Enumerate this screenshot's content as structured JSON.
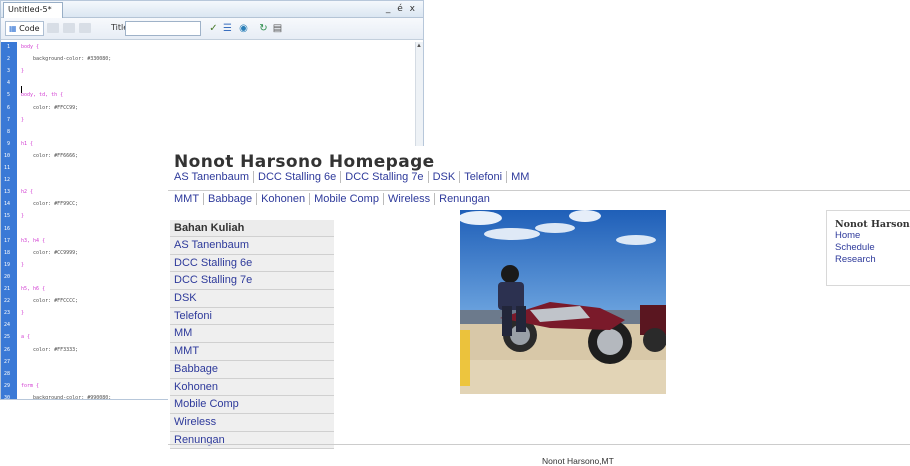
{
  "editor": {
    "tab_title": "Untitled-5*",
    "window_controls": "_ é x",
    "toolbar": {
      "code_label": "Code",
      "title_label": "Title:",
      "title_value": ""
    },
    "line_numbers": [
      "1",
      "2",
      "3",
      "4",
      "5",
      "6",
      "7",
      "8",
      "9",
      "10",
      "11",
      "12",
      "13",
      "14",
      "15",
      "16",
      "17",
      "18",
      "19",
      "20",
      "21",
      "22",
      "23",
      "24",
      "25",
      "26",
      "27",
      "28",
      "29",
      "30"
    ],
    "code_lines": [
      {
        "sel": "body {",
        "prop": ""
      },
      {
        "sel": "",
        "prop": "    background-color: #330080;"
      },
      {
        "sel": "}",
        "prop": ""
      },
      {
        "sel": "",
        "prop": ""
      },
      {
        "sel": "body, td, th {",
        "prop": ""
      },
      {
        "sel": "",
        "prop": "    color: #FFCC99;"
      },
      {
        "sel": "}",
        "prop": ""
      },
      {
        "sel": "",
        "prop": ""
      },
      {
        "sel": "h1 {",
        "prop": ""
      },
      {
        "sel": "",
        "prop": "    color: #FF6666;"
      },
      {
        "sel": "",
        "prop": ""
      },
      {
        "sel": "",
        "prop": ""
      },
      {
        "sel": "h2 {",
        "prop": ""
      },
      {
        "sel": "",
        "prop": "    color: #FF99CC;"
      },
      {
        "sel": "}",
        "prop": ""
      },
      {
        "sel": "",
        "prop": ""
      },
      {
        "sel": "h3, h4 {",
        "prop": ""
      },
      {
        "sel": "",
        "prop": "    color: #CC9999;"
      },
      {
        "sel": "}",
        "prop": ""
      },
      {
        "sel": "",
        "prop": ""
      },
      {
        "sel": "h5, h6 {",
        "prop": ""
      },
      {
        "sel": "",
        "prop": "    color: #FFCCCC;"
      },
      {
        "sel": "}",
        "prop": ""
      },
      {
        "sel": "",
        "prop": ""
      },
      {
        "sel": "a {",
        "prop": ""
      },
      {
        "sel": "",
        "prop": "    color: #FF3333;"
      },
      {
        "sel": "",
        "prop": ""
      },
      {
        "sel": "",
        "prop": ""
      },
      {
        "sel": "form {",
        "prop": ""
      },
      {
        "sel": "",
        "prop": "    background-color: #990080;"
      }
    ]
  },
  "site": {
    "title": "Nonot Harsono Homepage",
    "nav_row1": [
      "AS Tanenbaum",
      "DCC Stalling 6e",
      "DCC Stalling 7e",
      "DSK",
      "Telefoni",
      "MM"
    ],
    "nav_row2": [
      "MMT",
      "Babbage",
      "Kohonen",
      "Mobile Comp",
      "Wireless",
      "Renungan"
    ],
    "sidebar": {
      "heading": "Bahan Kuliah",
      "items": [
        "AS Tanenbaum",
        "DCC Stalling 6e",
        "DCC Stalling 7e",
        "DSK",
        "Telefoni",
        "MM",
        "MMT",
        "Babbage",
        "Kohonen",
        "Mobile Comp",
        "Wireless",
        "Renungan"
      ]
    },
    "right_box": {
      "name": "Nonot Harsono",
      "links": [
        "Home",
        "Schedule",
        "Research"
      ]
    },
    "footer": "Nonot Harsono,MT"
  },
  "colors": {
    "gutter": "#3a79d6",
    "link": "#2e3a9b",
    "selector": "#d13bd1"
  }
}
